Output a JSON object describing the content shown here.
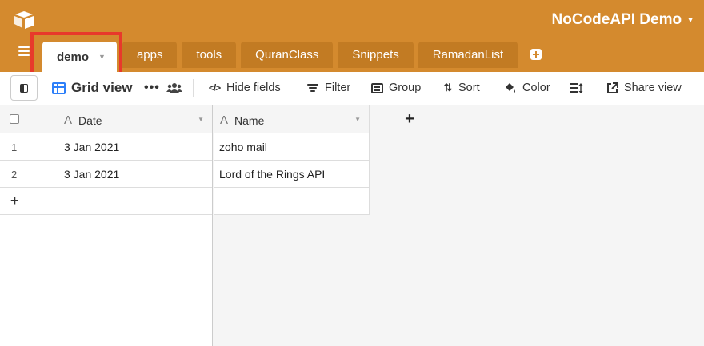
{
  "header": {
    "base_name": "NoCodeAPI Demo",
    "tabs": [
      {
        "label": "demo",
        "active": true
      },
      {
        "label": "apps"
      },
      {
        "label": "tools"
      },
      {
        "label": "QuranClass"
      },
      {
        "label": "Snippets"
      },
      {
        "label": "RamadanList"
      }
    ]
  },
  "toolbar": {
    "view_name": "Grid view",
    "more": "•••",
    "hide_fields": "Hide fields",
    "filter": "Filter",
    "group": "Group",
    "sort": "Sort",
    "color": "Color",
    "share_view": "Share view"
  },
  "grid": {
    "columns": [
      {
        "name": "Date",
        "type_icon": "A"
      },
      {
        "name": "Name",
        "type_icon": "A"
      }
    ],
    "add_field": "+",
    "add_row": "+",
    "rows": [
      {
        "num": "1",
        "date": "3 Jan 2021",
        "name": "zoho mail"
      },
      {
        "num": "2",
        "date": "3 Jan 2021",
        "name": "Lord of the Rings API"
      }
    ]
  },
  "colors": {
    "header": "#d48a2e",
    "tab": "#c27b23",
    "accent": "#2d7ff9",
    "highlight": "#e8392b"
  }
}
